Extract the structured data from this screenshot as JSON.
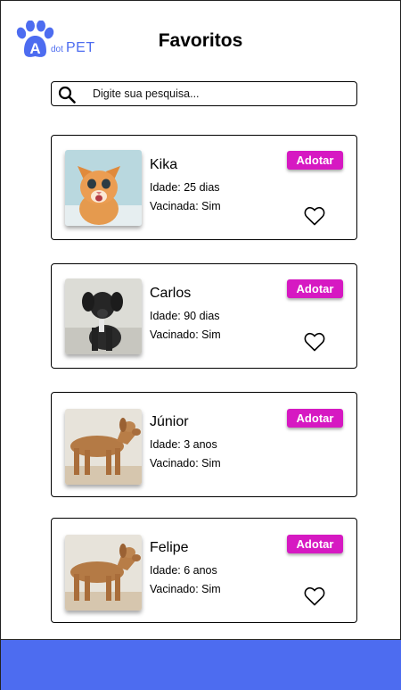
{
  "logo": {
    "letter": "A",
    "small": "dot",
    "big": "PET",
    "color": "#4d6cf0"
  },
  "header": {
    "title": "Favoritos"
  },
  "search": {
    "placeholder": "Digite sua pesquisa..."
  },
  "colors": {
    "accent": "#d619c2",
    "brand": "#4d6cf0"
  },
  "favorites": [
    {
      "name": "Kika",
      "age": "Idade: 25 dias",
      "vaccinated": "Vacinada: Sim",
      "adopt_label": "Adotar",
      "photo": "orange-kitten"
    },
    {
      "name": "Carlos",
      "age": "Idade: 90 dias",
      "vaccinated": "Vacinado: Sim",
      "adopt_label": "Adotar",
      "photo": "black-puppy"
    },
    {
      "name": "Júnior",
      "age": "Idade: 3 anos",
      "vaccinated": "Vacinado: Sim",
      "adopt_label": "Adotar",
      "photo": "brown-dog"
    },
    {
      "name": "Felipe",
      "age": "Idade: 6 anos",
      "vaccinated": "Vacinado: Sim",
      "adopt_label": "Adotar",
      "photo": "brown-dog"
    }
  ]
}
